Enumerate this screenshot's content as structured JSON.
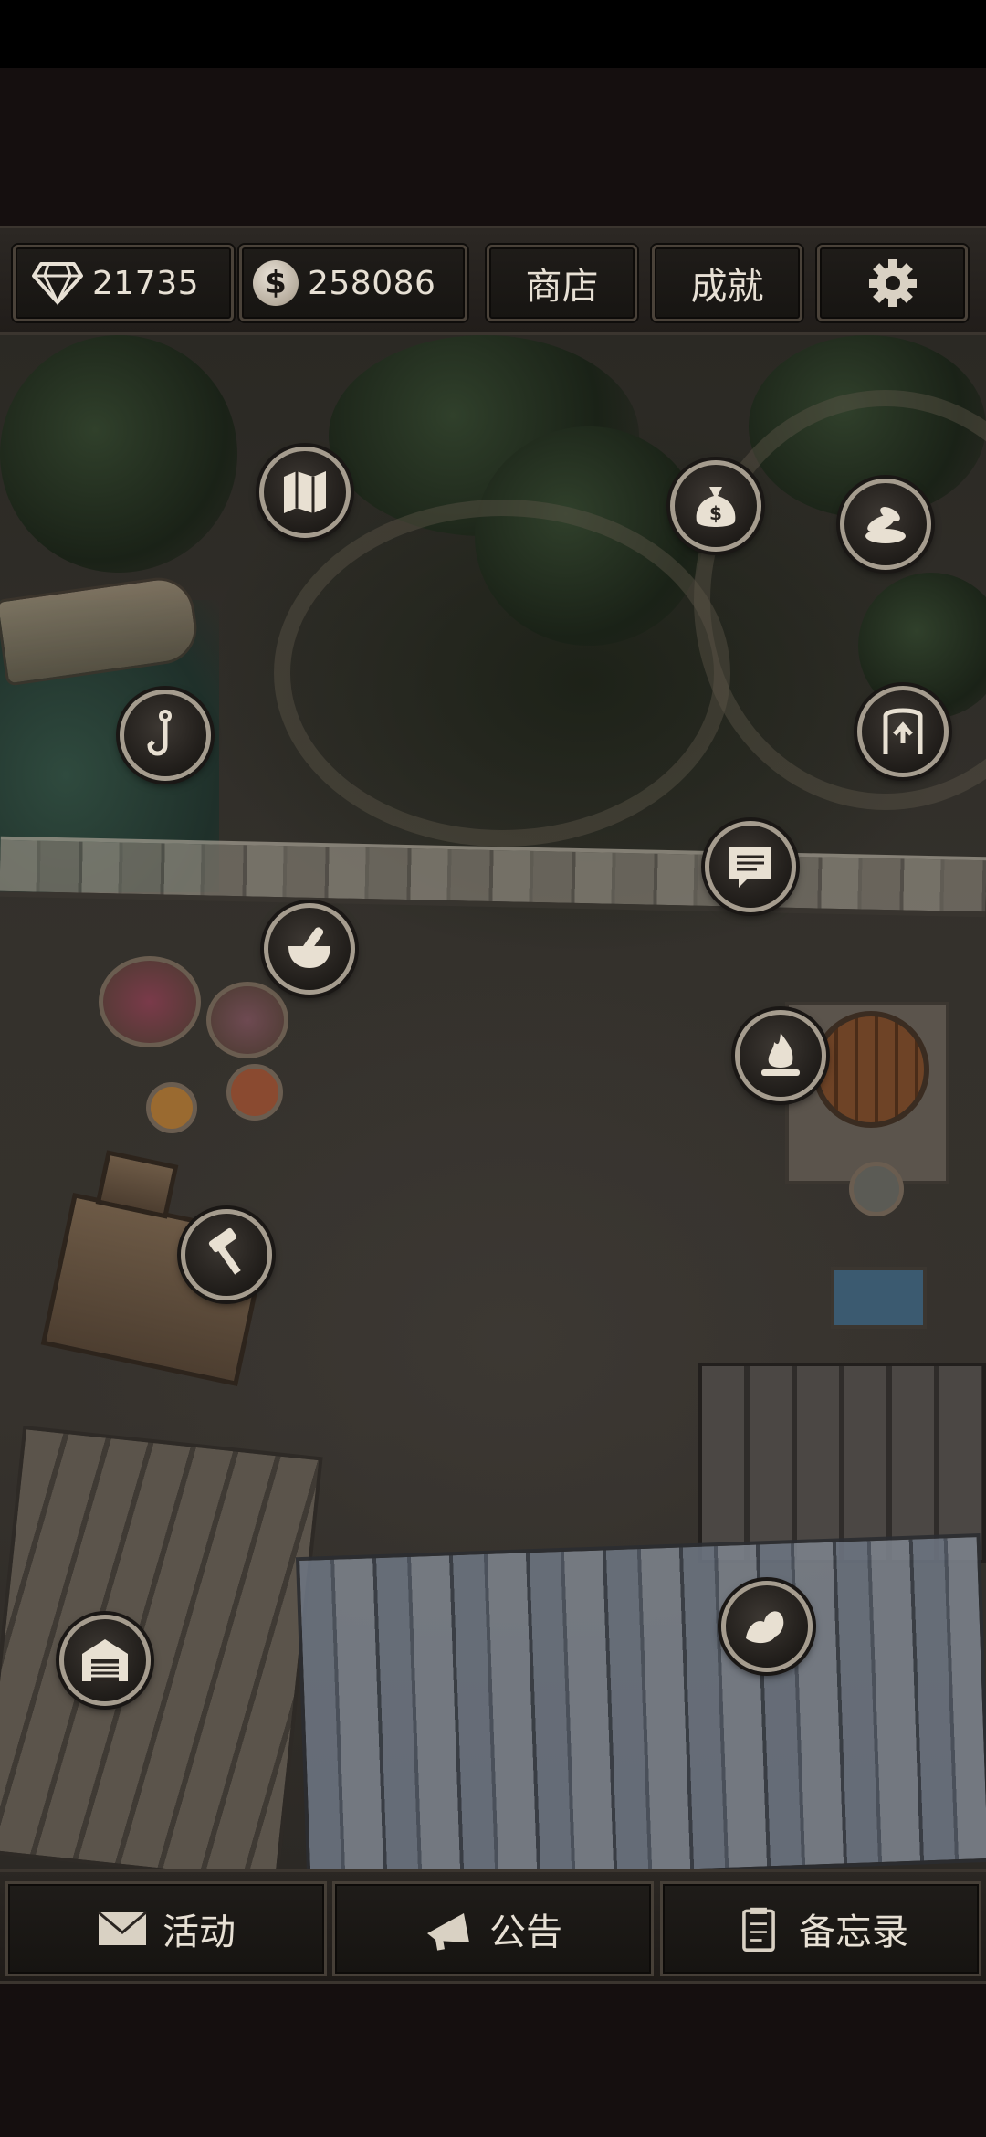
{
  "topbar": {
    "gems": "21735",
    "coins": "258086",
    "shop_label": "商店",
    "achievements_label": "成就",
    "settings_icon": "gear-icon"
  },
  "map_icons": [
    {
      "name": "map-icon",
      "icon": "map"
    },
    {
      "name": "money-bag-icon",
      "icon": "money-bag"
    },
    {
      "name": "coins-hand-icon",
      "icon": "coins"
    },
    {
      "name": "fishing-hook-icon",
      "icon": "hook"
    },
    {
      "name": "exit-gate-icon",
      "icon": "exit"
    },
    {
      "name": "message-icon",
      "icon": "chat"
    },
    {
      "name": "mortar-pestle-icon",
      "icon": "mortar"
    },
    {
      "name": "campfire-icon",
      "icon": "fire"
    },
    {
      "name": "hammer-craft-icon",
      "icon": "hammer"
    },
    {
      "name": "warehouse-icon",
      "icon": "warehouse"
    },
    {
      "name": "strength-arm-icon",
      "icon": "arm"
    }
  ],
  "bottombar": {
    "events_label": "活动",
    "announcement_label": "公告",
    "memo_label": "备忘录"
  },
  "colors": {
    "background": "#150f0f",
    "bar": "#2b2723",
    "text": "#e7e0d4",
    "icon_ring": "#a59c8e"
  }
}
